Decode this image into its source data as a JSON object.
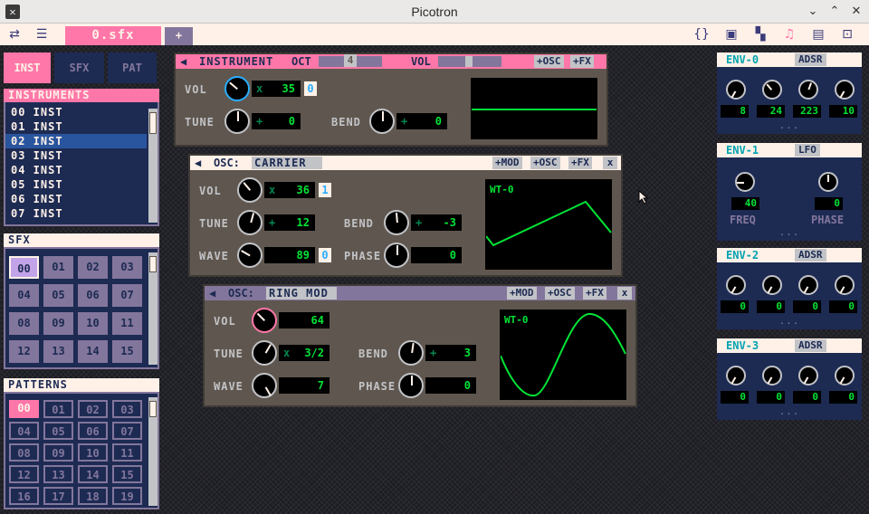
{
  "window": {
    "title": "Picotron"
  },
  "toolbar": {
    "file_tab": "0.sfx",
    "add_tab": "+"
  },
  "modes": {
    "inst": "INST",
    "sfx": "SFX",
    "pat": "PAT"
  },
  "instruments": {
    "header": "INSTRUMENTS",
    "items": [
      "00 INST",
      "01 INST",
      "02 INST",
      "03 INST",
      "04 INST",
      "05 INST",
      "06 INST",
      "07 INST"
    ],
    "selected": 2
  },
  "sfx": {
    "header": "SFX",
    "items": [
      "00",
      "01",
      "02",
      "03",
      "04",
      "05",
      "06",
      "07",
      "08",
      "09",
      "10",
      "11",
      "12",
      "13",
      "14",
      "15"
    ]
  },
  "patterns": {
    "header": "PATTERNS",
    "items": [
      "00",
      "01",
      "02",
      "03",
      "04",
      "05",
      "06",
      "07",
      "08",
      "09",
      "10",
      "11",
      "12",
      "13",
      "14",
      "15",
      "16",
      "17",
      "18",
      "19"
    ]
  },
  "instrument": {
    "title": "INSTRUMENT",
    "oct_label": "OCT",
    "oct_value": "4",
    "vol_label": "VOL",
    "btn_osc": "+OSC",
    "btn_fx": "+FX",
    "vol": {
      "label": "VOL",
      "sym": "x",
      "value": "35",
      "flag": "0"
    },
    "tune": {
      "label": "TUNE",
      "sym": "+",
      "value": "0"
    },
    "bend": {
      "label": "BEND",
      "sym": "+",
      "value": "0"
    }
  },
  "osc1": {
    "title": "OSC:",
    "name": "CARRIER",
    "btn_mod": "+MOD",
    "btn_osc": "+OSC",
    "btn_fx": "+FX",
    "close": "x",
    "wt": "WT-0",
    "vol": {
      "label": "VOL",
      "sym": "x",
      "value": "36",
      "flag": "1"
    },
    "tune": {
      "label": "TUNE",
      "sym": "+",
      "value": "12"
    },
    "bend": {
      "label": "BEND",
      "sym": "+",
      "value": "-3"
    },
    "wave": {
      "label": "WAVE",
      "value": "89",
      "flag": "0"
    },
    "phase": {
      "label": "PHASE",
      "value": "0"
    }
  },
  "osc2": {
    "title": "OSC:",
    "name": "RING MOD",
    "btn_mod": "+MOD",
    "btn_osc": "+OSC",
    "btn_fx": "+FX",
    "close": "x",
    "wt": "WT-0",
    "vol": {
      "label": "VOL",
      "value": "64"
    },
    "tune": {
      "label": "TUNE",
      "sym": "x",
      "value": "3/2"
    },
    "bend": {
      "label": "BEND",
      "sym": "+",
      "value": "3"
    },
    "wave": {
      "label": "WAVE",
      "value": "7"
    },
    "phase": {
      "label": "PHASE",
      "value": "0"
    }
  },
  "env0": {
    "name": "ENV-0",
    "type": "ADSR",
    "values": [
      "8",
      "24",
      "223",
      "10"
    ],
    "more": "..."
  },
  "env1": {
    "name": "ENV-1",
    "type": "LFO",
    "freq": "40",
    "phase": "0",
    "freq_label": "FREQ",
    "phase_label": "PHASE",
    "more": "..."
  },
  "env2": {
    "name": "ENV-2",
    "type": "ADSR",
    "values": [
      "0",
      "0",
      "0",
      "0"
    ],
    "more": "..."
  },
  "env3": {
    "name": "ENV-3",
    "type": "ADSR",
    "values": [
      "0",
      "0",
      "0",
      "0"
    ],
    "more": "..."
  },
  "colors": {
    "pink": "#ff77a8",
    "navy": "#1d2b53",
    "green": "#00e436",
    "lavender": "#83769c",
    "cream": "#fff1e8",
    "brown": "#5f574f"
  }
}
